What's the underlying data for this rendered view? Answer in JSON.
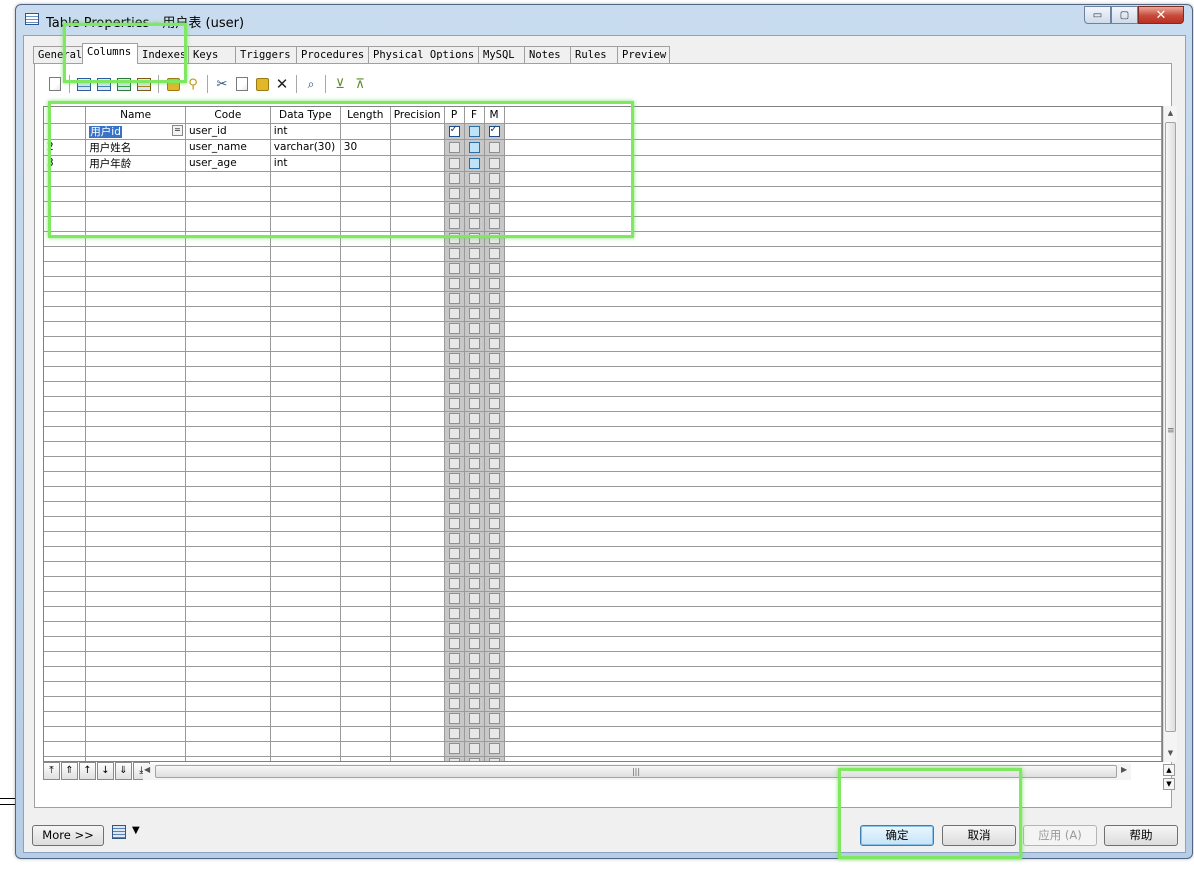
{
  "window": {
    "title": "Table Properties - 用户表 (user)",
    "minimize_glyph": "▭",
    "maximize_glyph": "▢",
    "close_glyph": "✕"
  },
  "tabs": [
    {
      "label": "General",
      "active": false
    },
    {
      "label": "Columns",
      "active": true
    },
    {
      "label": "Indexes",
      "active": false
    },
    {
      "label": "Keys",
      "active": false
    },
    {
      "label": "Triggers",
      "active": false
    },
    {
      "label": "Procedures",
      "active": false
    },
    {
      "label": "Physical Options",
      "active": false
    },
    {
      "label": "MySQL",
      "active": false
    },
    {
      "label": "Notes",
      "active": false
    },
    {
      "label": "Rules",
      "active": false
    },
    {
      "label": "Preview",
      "active": false
    }
  ],
  "toolbar": {
    "icons": [
      "properties-icon",
      "add-row-icon",
      "insert-row-icon",
      "add-rows-icon",
      "paste-rows-icon",
      "new-icon",
      "find-icon",
      "cut-icon",
      "copy-icon",
      "paste-icon",
      "delete-icon",
      "find-in-list-icon",
      "filter-icon",
      "clear-filter-icon"
    ]
  },
  "grid": {
    "columns": [
      "Name",
      "Code",
      "Data Type",
      "Length",
      "Precision",
      "P",
      "F",
      "M"
    ],
    "rows": [
      {
        "num": "",
        "name": "用户id",
        "code": "user_id",
        "data_type": "int",
        "length": "",
        "precision": "",
        "p": true,
        "f": "blue",
        "m": true
      },
      {
        "num": "2",
        "name": "用户姓名",
        "code": "user_name",
        "data_type": "varchar(30)",
        "length": "30",
        "precision": "",
        "p": false,
        "f": "blue",
        "m": false
      },
      {
        "num": "3",
        "name": "用户年龄",
        "code": "user_age",
        "data_type": "int",
        "length": "",
        "precision": "",
        "p": false,
        "f": "blue",
        "m": false
      }
    ],
    "ellipsis_glyph": "="
  },
  "nav_buttons": [
    "⤒",
    "⇑",
    "↑",
    "↓",
    "⇓",
    "⤓"
  ],
  "bottom": {
    "more_label": "More >>",
    "ok_label": "确定",
    "cancel_label": "取消",
    "apply_label": "应用 (A)",
    "help_label": "帮助",
    "dropdown_glyph": "▼"
  },
  "colors": {
    "highlight": "#7fe860",
    "selection": "#3a73c6",
    "checkbox_blue": "#bfe2f7"
  }
}
